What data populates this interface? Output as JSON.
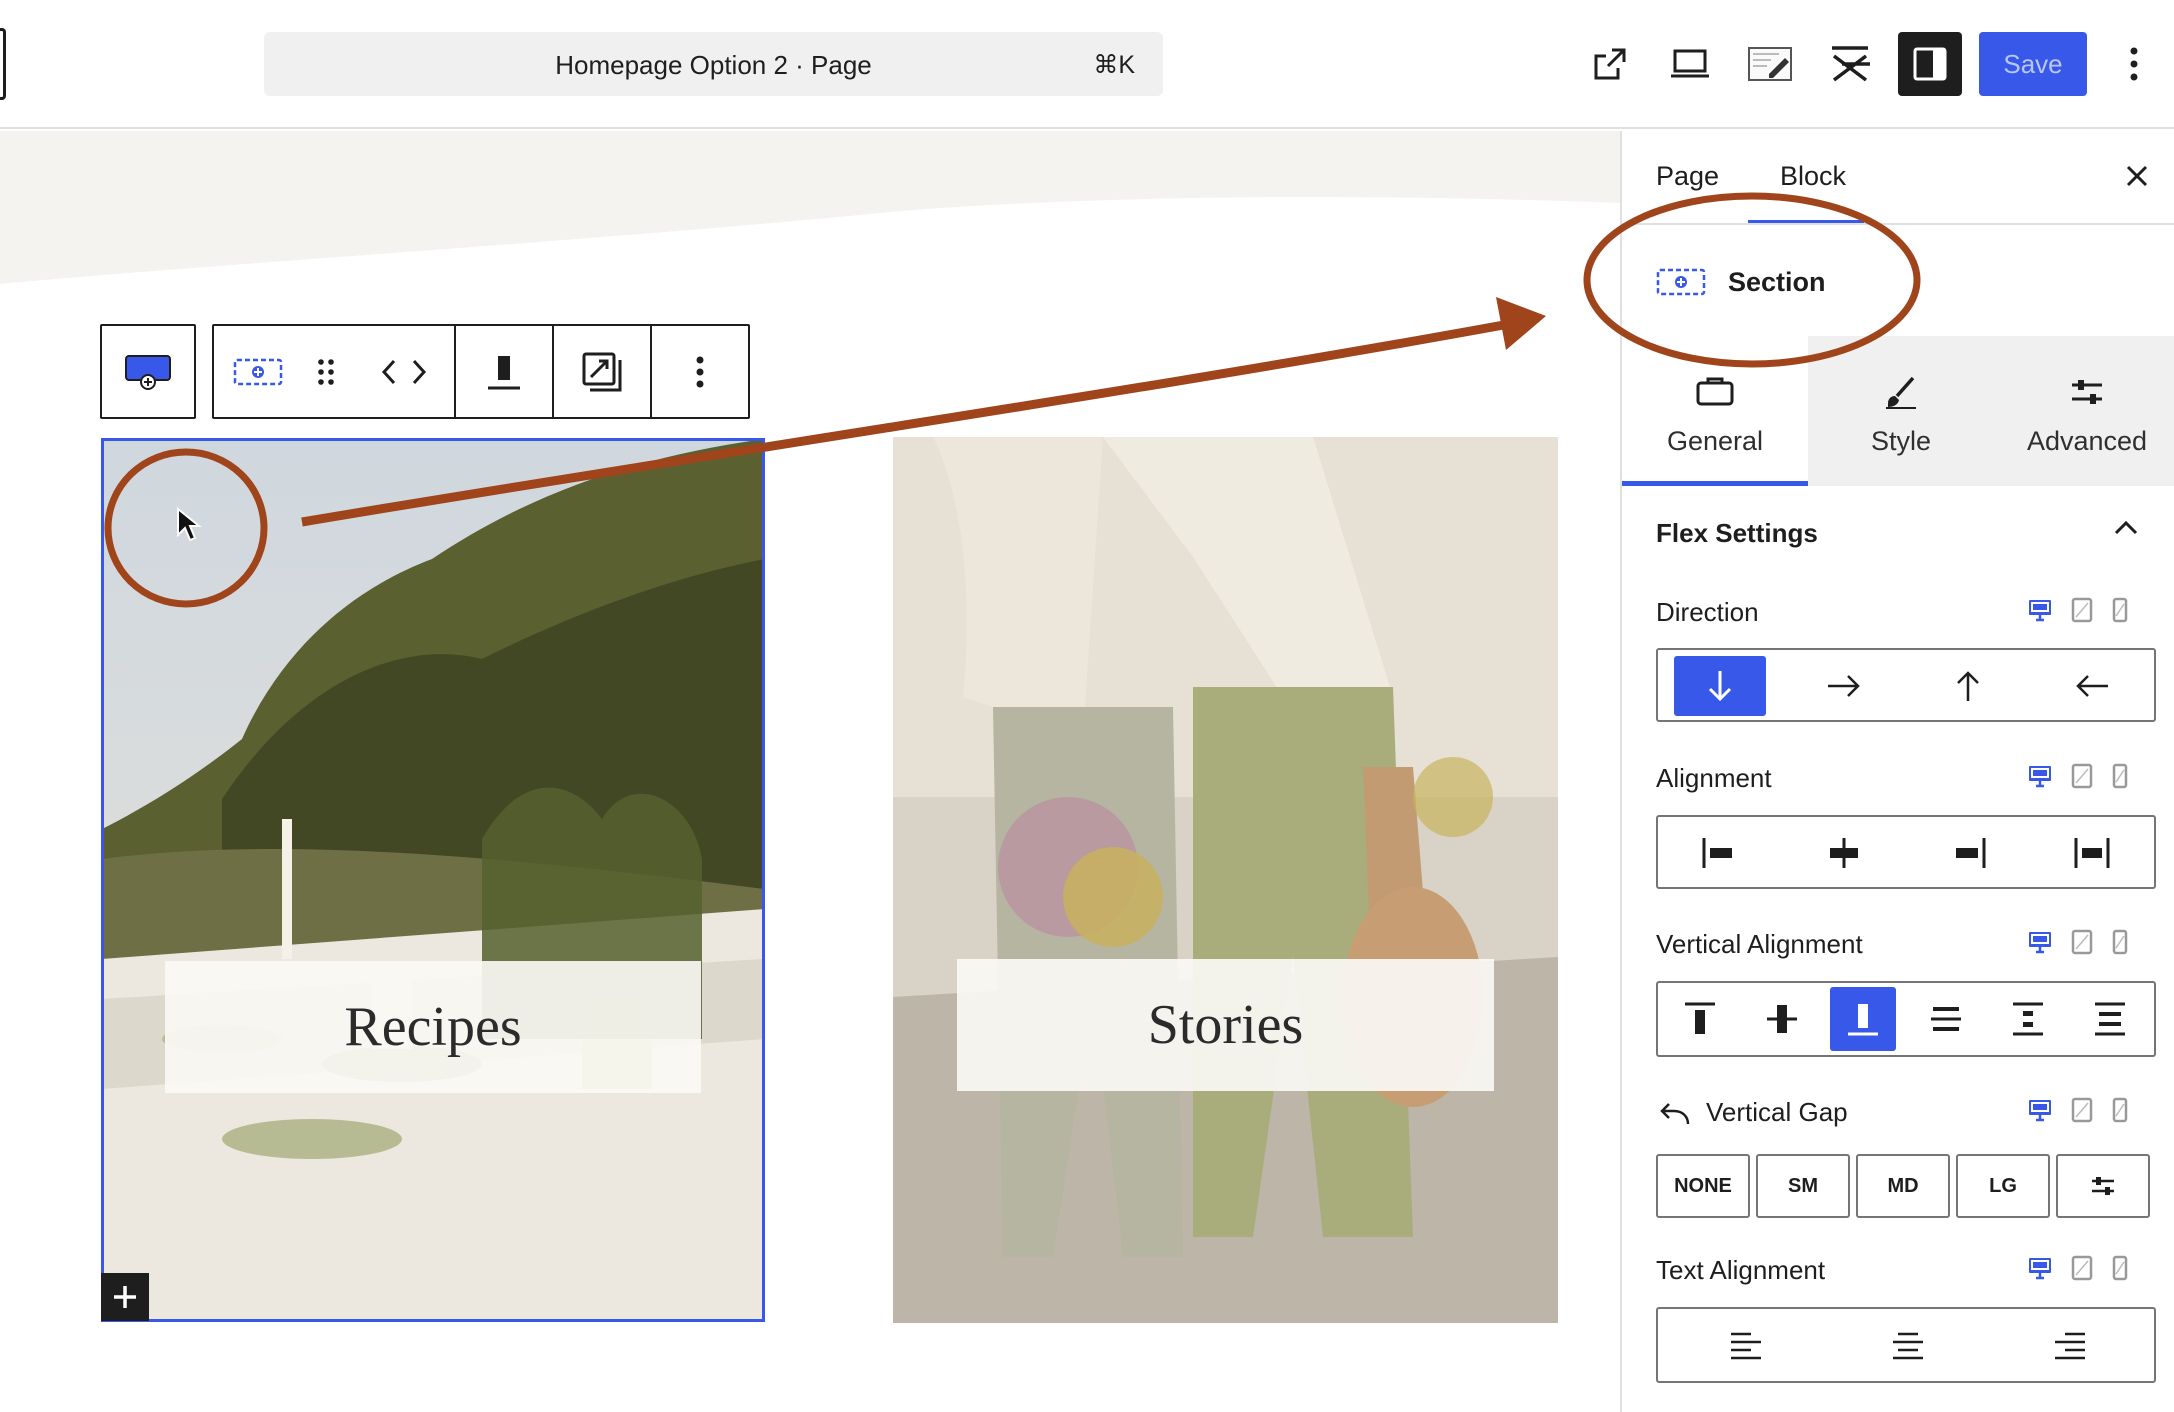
{
  "topbar": {
    "command_title": "Homepage Option 2 · Page",
    "command_shortcut": "⌘K",
    "save_label": "Save",
    "icons": [
      "external-link-icon",
      "desktop-preview-icon",
      "notes-icon",
      "stackable-icon",
      "sidebar-toggle-icon",
      "more-vertical-icon"
    ]
  },
  "canvas": {
    "cards": [
      {
        "label": "Recipes"
      },
      {
        "label": "Stories"
      }
    ]
  },
  "sidebar": {
    "tabs": [
      {
        "label": "Page"
      },
      {
        "label": "Block",
        "active": true
      }
    ],
    "block_title": "Section",
    "settings_tabs": [
      {
        "label": "General",
        "active": true
      },
      {
        "label": "Style"
      },
      {
        "label": "Advanced"
      }
    ],
    "panel_title": "Flex Settings",
    "fields": {
      "direction": "Direction",
      "alignment": "Alignment",
      "vertical_alignment": "Vertical Alignment",
      "vertical_gap": "Vertical Gap",
      "text_alignment": "Text Alignment"
    },
    "gap_options": [
      "NONE",
      "SM",
      "MD",
      "LG"
    ]
  },
  "colors": {
    "accent": "#3858e9",
    "annotation": "#a0441c"
  }
}
